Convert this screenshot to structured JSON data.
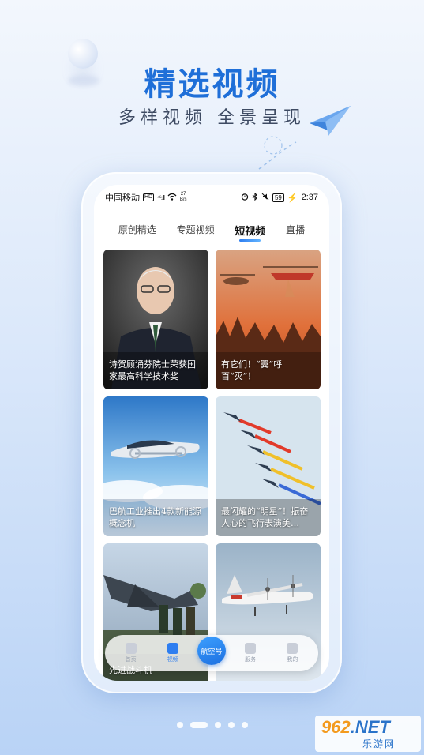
{
  "promo": {
    "headline": "精选视频",
    "subline": "多样视频 全景呈现"
  },
  "statusbar": {
    "carrier": "中国移动",
    "hd": "HD",
    "signal": "⁴⁶.ıll",
    "netspeed_value": "27",
    "netspeed_unit": "B/s",
    "battery": "59",
    "time": "2:37"
  },
  "tabs": [
    {
      "label": "原创精选",
      "active": false
    },
    {
      "label": "专题视频",
      "active": false
    },
    {
      "label": "短视频",
      "active": true
    },
    {
      "label": "直播",
      "active": false
    }
  ],
  "cards": [
    {
      "caption": "诗贺顾诵芬院士荣获国家最高科学技术奖",
      "scene": "portrait"
    },
    {
      "caption": "有它们！“翼”呼百“灭”！",
      "scene": "firefight"
    },
    {
      "caption": "巴航工业推出4款新能源概念机",
      "scene": "concept"
    },
    {
      "caption": "最闪耀的“明星”！振奋人心的飞行表演美…",
      "scene": "formation"
    },
    {
      "caption": "先进战斗机",
      "scene": "jet"
    },
    {
      "caption": "",
      "scene": "turboprop"
    }
  ],
  "bottomnav": {
    "items": [
      {
        "label": "首页",
        "icon": "home-icon"
      },
      {
        "label": "视频",
        "icon": "video-icon"
      },
      {
        "label": "航空号",
        "icon": "center-icon"
      },
      {
        "label": "服务",
        "icon": "heart-icon"
      },
      {
        "label": "我的",
        "icon": "user-icon"
      }
    ]
  },
  "pager": {
    "count": 5,
    "active_index": 1
  },
  "watermark": {
    "brand": "962",
    "domain": ".NET",
    "site_name": "乐游网"
  },
  "colors": {
    "accent": "#1f6fd8",
    "tab_indicator": "#2e7ef0"
  }
}
